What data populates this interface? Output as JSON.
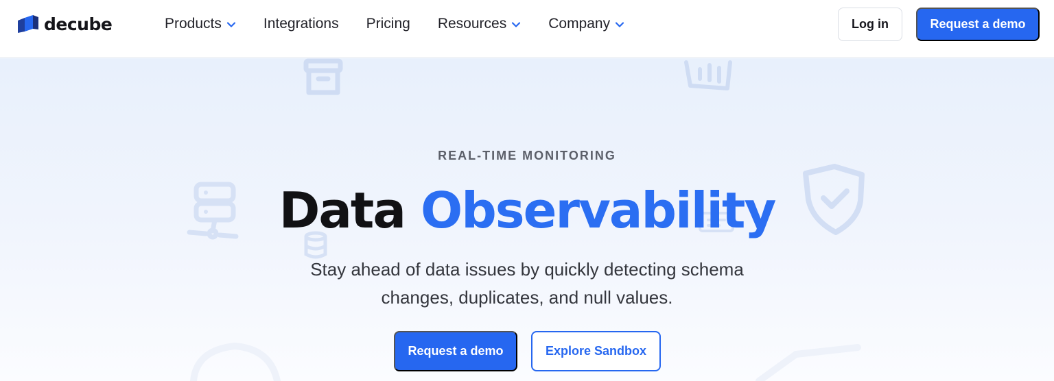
{
  "header": {
    "brand": "decube",
    "nav": [
      {
        "label": "Products",
        "has_dropdown": true
      },
      {
        "label": "Integrations",
        "has_dropdown": false
      },
      {
        "label": "Pricing",
        "has_dropdown": false
      },
      {
        "label": "Resources",
        "has_dropdown": true
      },
      {
        "label": "Company",
        "has_dropdown": true
      }
    ],
    "login_label": "Log in",
    "demo_label": "Request a demo"
  },
  "hero": {
    "eyebrow": "REAL-TIME MONITORING",
    "title_plain": "Data",
    "title_accent": "Observability",
    "subtitle_line1": "Stay ahead of data issues by quickly detecting schema",
    "subtitle_line2": "changes, duplicates, and null values.",
    "primary_cta": "Request a demo",
    "secondary_cta": "Explore Sandbox",
    "decorative_icons": [
      "archive-box-icon",
      "bar-chart-icon",
      "server-network-icon",
      "database-icon",
      "shield-check-icon",
      "dashboard-icon"
    ]
  },
  "colors": {
    "brand_blue": "#2667f0",
    "accent_text": "#2b6ef2",
    "hero_bg": "#e8f0fc",
    "text_dark": "#111114"
  }
}
